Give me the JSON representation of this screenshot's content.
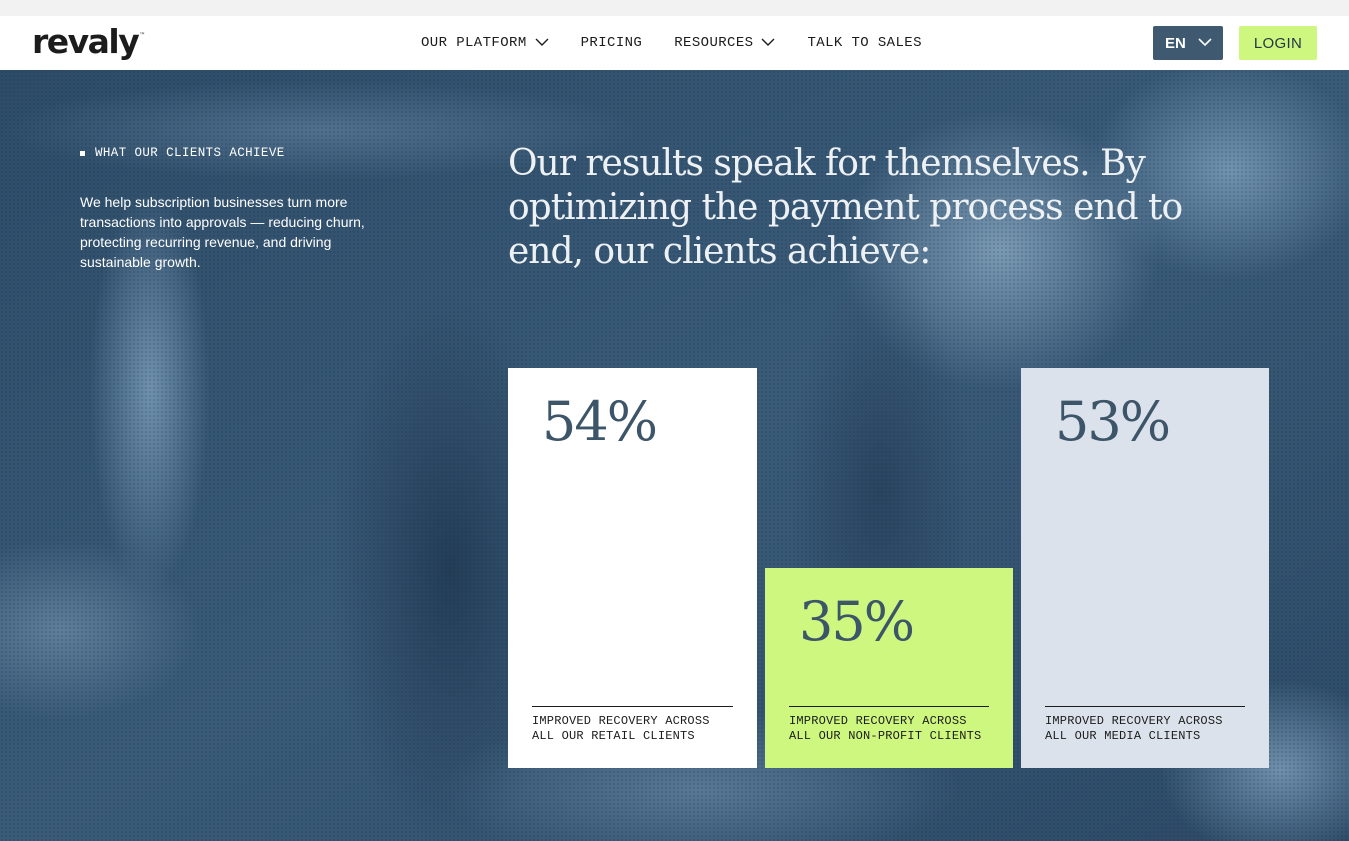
{
  "nav": {
    "logo": "revaly",
    "logo_mark": "™",
    "items": [
      {
        "label": "OUR PLATFORM",
        "has_dropdown": true
      },
      {
        "label": "PRICING",
        "has_dropdown": false
      },
      {
        "label": "RESOURCES",
        "has_dropdown": true
      },
      {
        "label": "TALK TO SALES",
        "has_dropdown": false
      }
    ],
    "language": "EN",
    "login": "LOGIN"
  },
  "hero": {
    "eyebrow": "WHAT OUR CLIENTS ACHIEVE",
    "intro": "We help subscription businesses turn more transactions into approvals — reducing churn, protecting recurring revenue, and driving sustainable growth.",
    "headline": "Our results speak for themselves. By optimizing the payment process end to end, our clients achieve:",
    "stats": [
      {
        "value": "54%",
        "caption_line1": "IMPROVED RECOVERY ACROSS",
        "caption_line2": "ALL OUR RETAIL CLIENTS"
      },
      {
        "value": "35%",
        "caption_line1": "IMPROVED RECOVERY ACROSS",
        "caption_line2": "ALL OUR NON-PROFIT CLIENTS"
      },
      {
        "value": "53%",
        "caption_line1": "IMPROVED RECOVERY ACROSS",
        "caption_line2": "ALL OUR MEDIA CLIENTS"
      }
    ]
  },
  "colors": {
    "hero_bg": "#345470",
    "accent_green": "#cdf77f",
    "lang_button": "#3f5a70",
    "card_light": "#dce2ec",
    "stat_text": "#3d5568"
  },
  "icons": [
    "chevron-down-icon"
  ]
}
